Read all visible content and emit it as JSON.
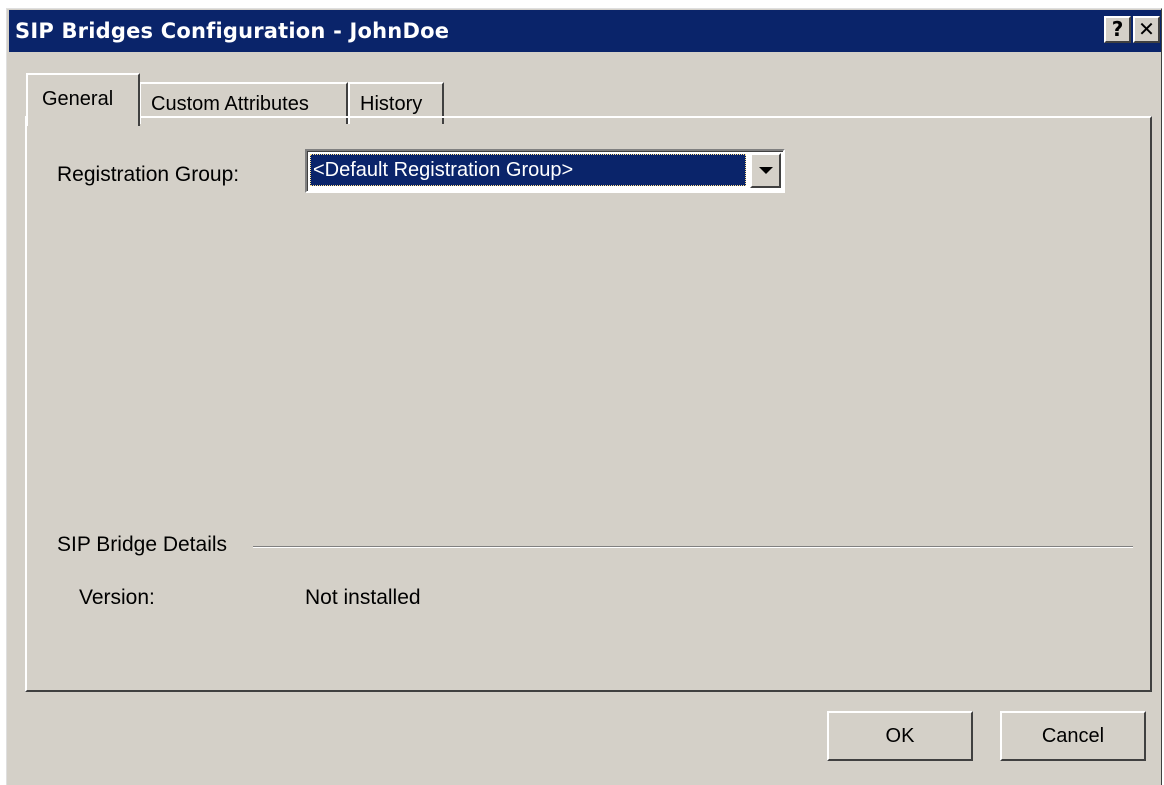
{
  "window": {
    "title": "SIP Bridges Configuration - JohnDoe",
    "help_glyph": "?",
    "close_glyph": "✕"
  },
  "tabs": [
    {
      "label": "General",
      "selected": true
    },
    {
      "label": "Custom Attributes",
      "selected": false
    },
    {
      "label": "History",
      "selected": false
    }
  ],
  "general": {
    "registration_group_label": "Registration Group:",
    "registration_group_value": "<Default Registration Group>",
    "details_group_label": "SIP Bridge Details",
    "version_label": "Version:",
    "version_value": "Not installed"
  },
  "buttons": {
    "ok_label": "OK",
    "cancel_label": "Cancel"
  },
  "colors": {
    "titlebar": "#0a246a",
    "dialog_face": "#d4d0c8",
    "selection": "#0a246a"
  },
  "icons": {
    "help": "help-icon",
    "close": "close-icon",
    "dropdown": "chevron-down-icon"
  }
}
